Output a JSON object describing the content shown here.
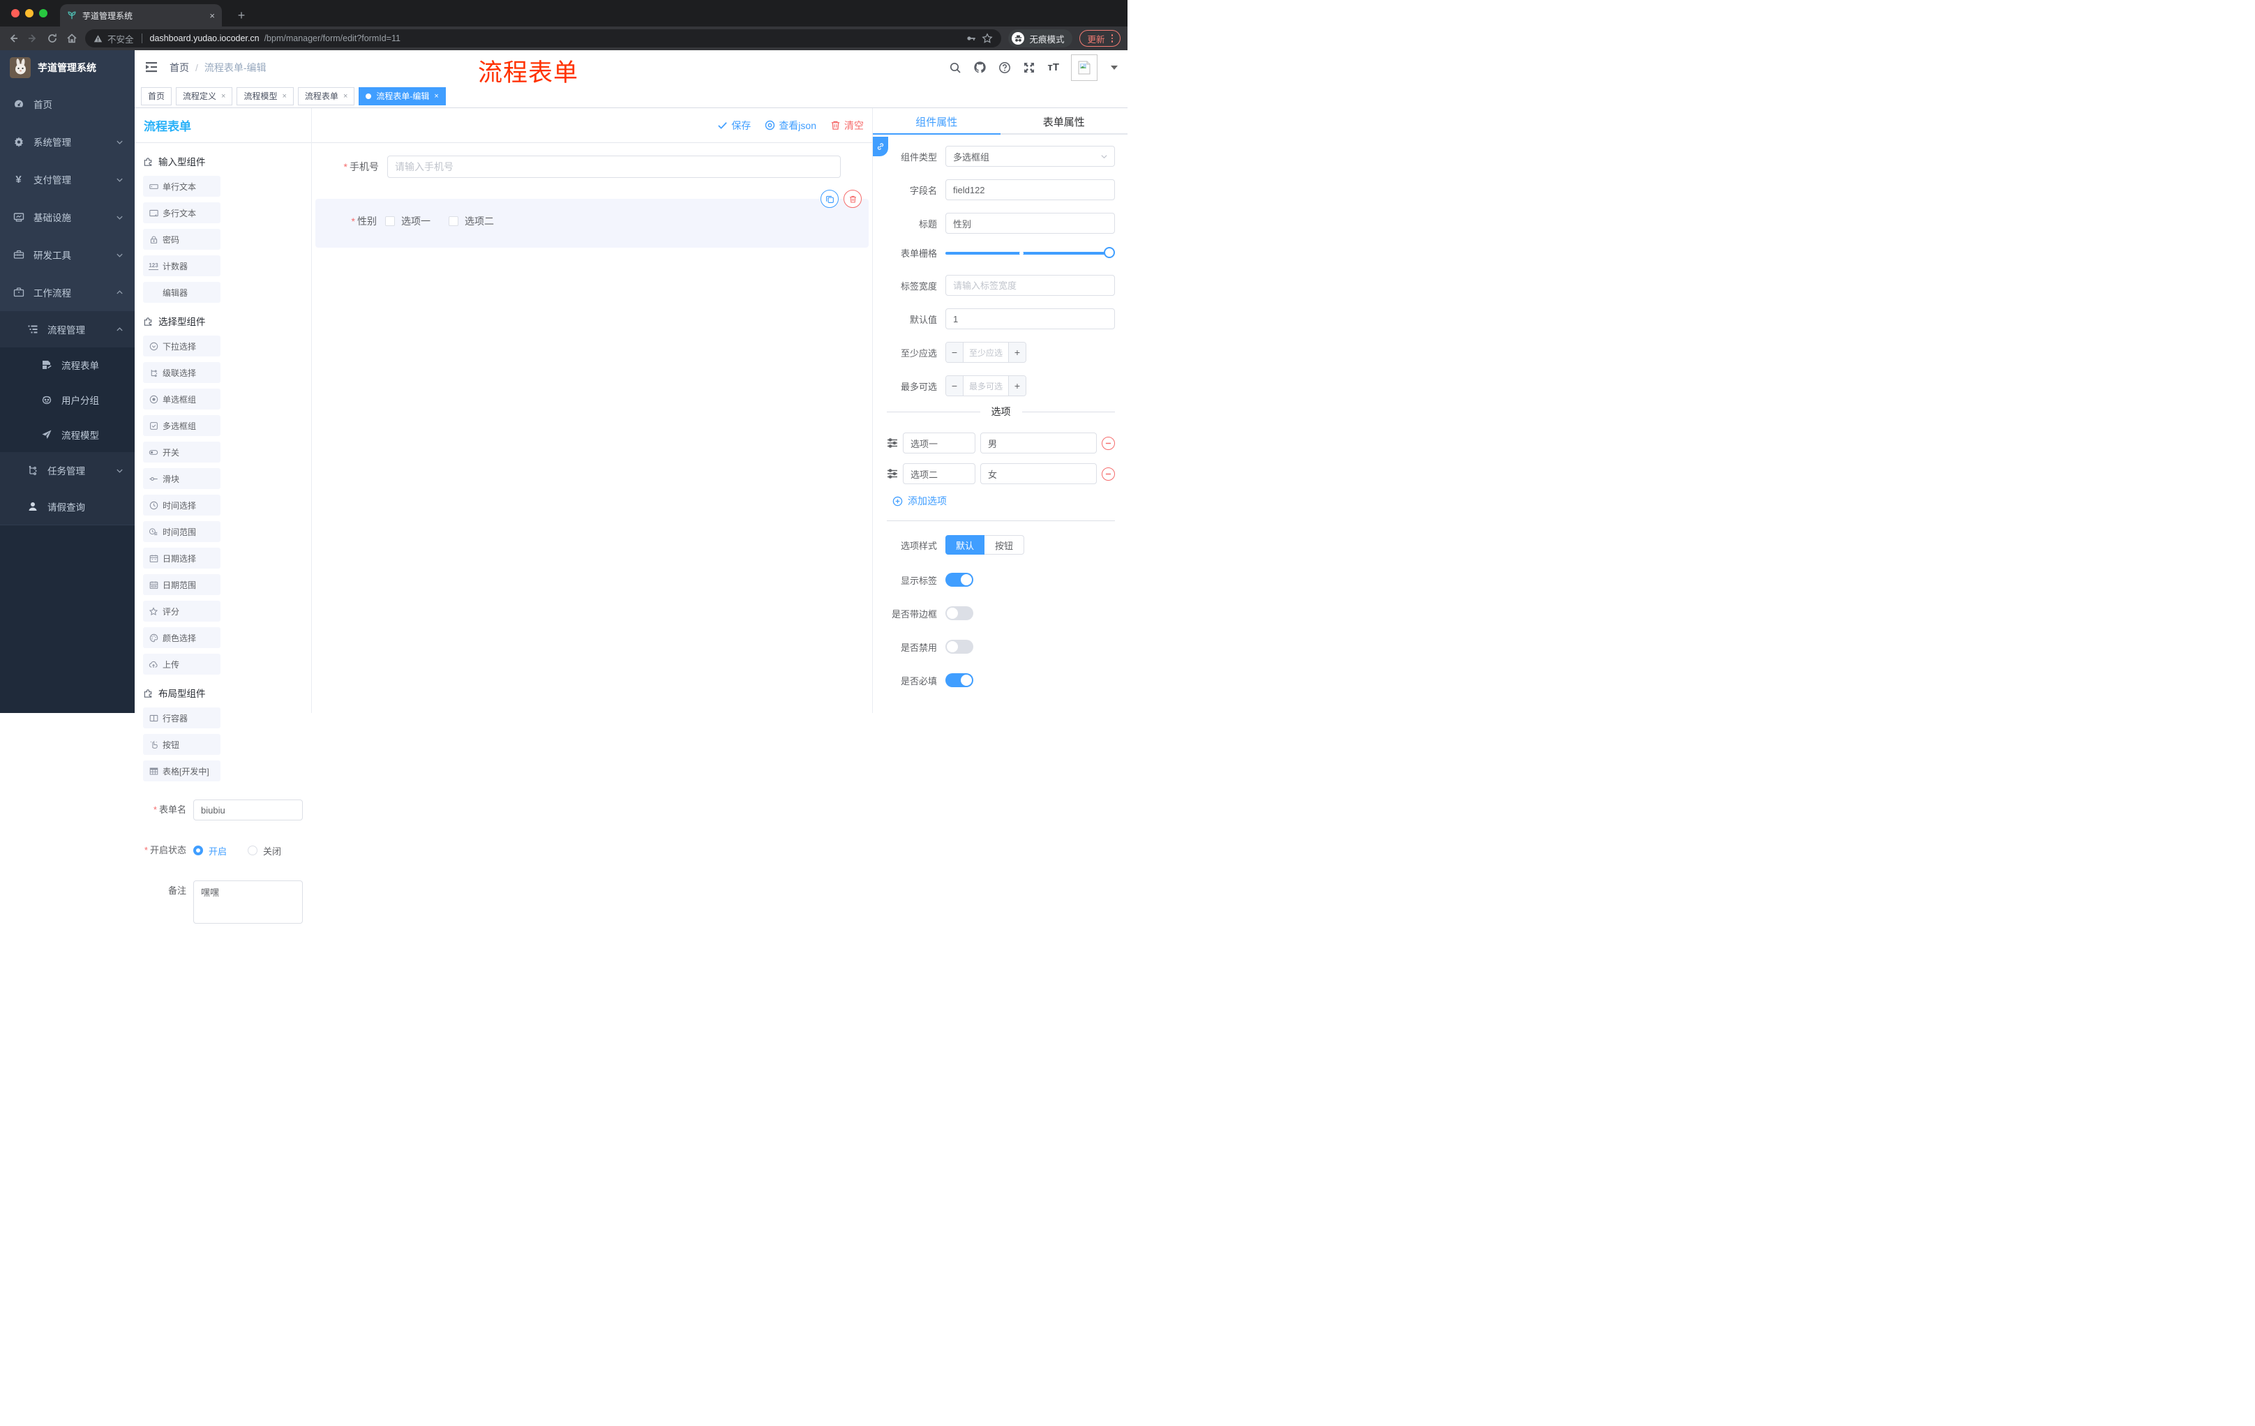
{
  "browser": {
    "tab_title": "芋道管理系统",
    "new_tab": "+",
    "close": "×",
    "security_warning": "不安全",
    "url_domain": "dashboard.yudao.iocoder.cn",
    "url_path": "/bpm/manager/form/edit?formId=11",
    "incognito_label": "无痕模式",
    "update_label": "更新"
  },
  "header": {
    "breadcrumb_home": "首页",
    "breadcrumb_sep": "/",
    "breadcrumb_current": "流程表单-编辑",
    "annotation": "流程表单"
  },
  "sidebar": {
    "brand": "芋道管理系统",
    "items": [
      {
        "label": "首页"
      },
      {
        "label": "系统管理"
      },
      {
        "label": "支付管理"
      },
      {
        "label": "基础设施"
      },
      {
        "label": "研发工具"
      },
      {
        "label": "工作流程"
      },
      {
        "label": "流程管理"
      },
      {
        "label": "流程表单"
      },
      {
        "label": "用户分组"
      },
      {
        "label": "流程模型"
      },
      {
        "label": "任务管理"
      },
      {
        "label": "请假查询"
      }
    ]
  },
  "tags": {
    "items": [
      {
        "label": "首页"
      },
      {
        "label": "流程定义"
      },
      {
        "label": "流程模型"
      },
      {
        "label": "流程表单"
      },
      {
        "label": "流程表单-编辑"
      }
    ]
  },
  "designer": {
    "panel_title": "流程表单",
    "actions": {
      "save": "保存",
      "view_json": "查看json",
      "clear": "清空"
    },
    "palette": {
      "sections": [
        {
          "title": "输入型组件",
          "items": [
            "单行文本",
            "多行文本",
            "密码",
            "计数器",
            "编辑器"
          ]
        },
        {
          "title": "选择型组件",
          "items": [
            "下拉选择",
            "级联选择",
            "单选框组",
            "多选框组",
            "开关",
            "滑块",
            "时间选择",
            "时间范围",
            "日期选择",
            "日期范围",
            "评分",
            "颜色选择",
            "上传"
          ]
        },
        {
          "title": "布局型组件",
          "items": [
            "行容器",
            "按钮",
            "表格[开发中]"
          ]
        }
      ]
    },
    "meta": {
      "name_label": "表单名",
      "name_value": "biubiu",
      "status_label": "开启状态",
      "status_on": "开启",
      "status_off": "关闭",
      "remark_label": "备注",
      "remark_value": "嘿嘿"
    },
    "canvas": {
      "phone_label": "手机号",
      "phone_placeholder": "请输入手机号",
      "gender_label": "性别",
      "option1": "选项一",
      "option2": "选项二"
    }
  },
  "props": {
    "tab_component": "组件属性",
    "tab_form": "表单属性",
    "type_label": "组件类型",
    "type_value": "多选框组",
    "field_label": "字段名",
    "field_value": "field122",
    "title_label": "标题",
    "title_value": "性别",
    "grid_label": "表单栅格",
    "width_label": "标签宽度",
    "width_placeholder": "请输入标签宽度",
    "default_label": "默认值",
    "default_value": "1",
    "min_label": "至少应选",
    "min_placeholder": "至少应选",
    "max_label": "最多可选",
    "max_placeholder": "最多可选",
    "options_title": "选项",
    "option_rows": [
      {
        "label": "选项一",
        "value": "男"
      },
      {
        "label": "选项二",
        "value": "女"
      }
    ],
    "add_option": "添加选项",
    "style_label": "选项样式",
    "style_default": "默认",
    "style_button": "按钮",
    "show_label_label": "显示标签",
    "border_label": "是否带边框",
    "disabled_label": "是否禁用",
    "required_label": "是否必填"
  },
  "colors": {
    "accent": "#409EFF",
    "danger": "#F56C6C",
    "annotation_red": "#FF3200",
    "designer_title_blue": "#29B1F8",
    "sidebar_bg": "#2F3B4E"
  }
}
